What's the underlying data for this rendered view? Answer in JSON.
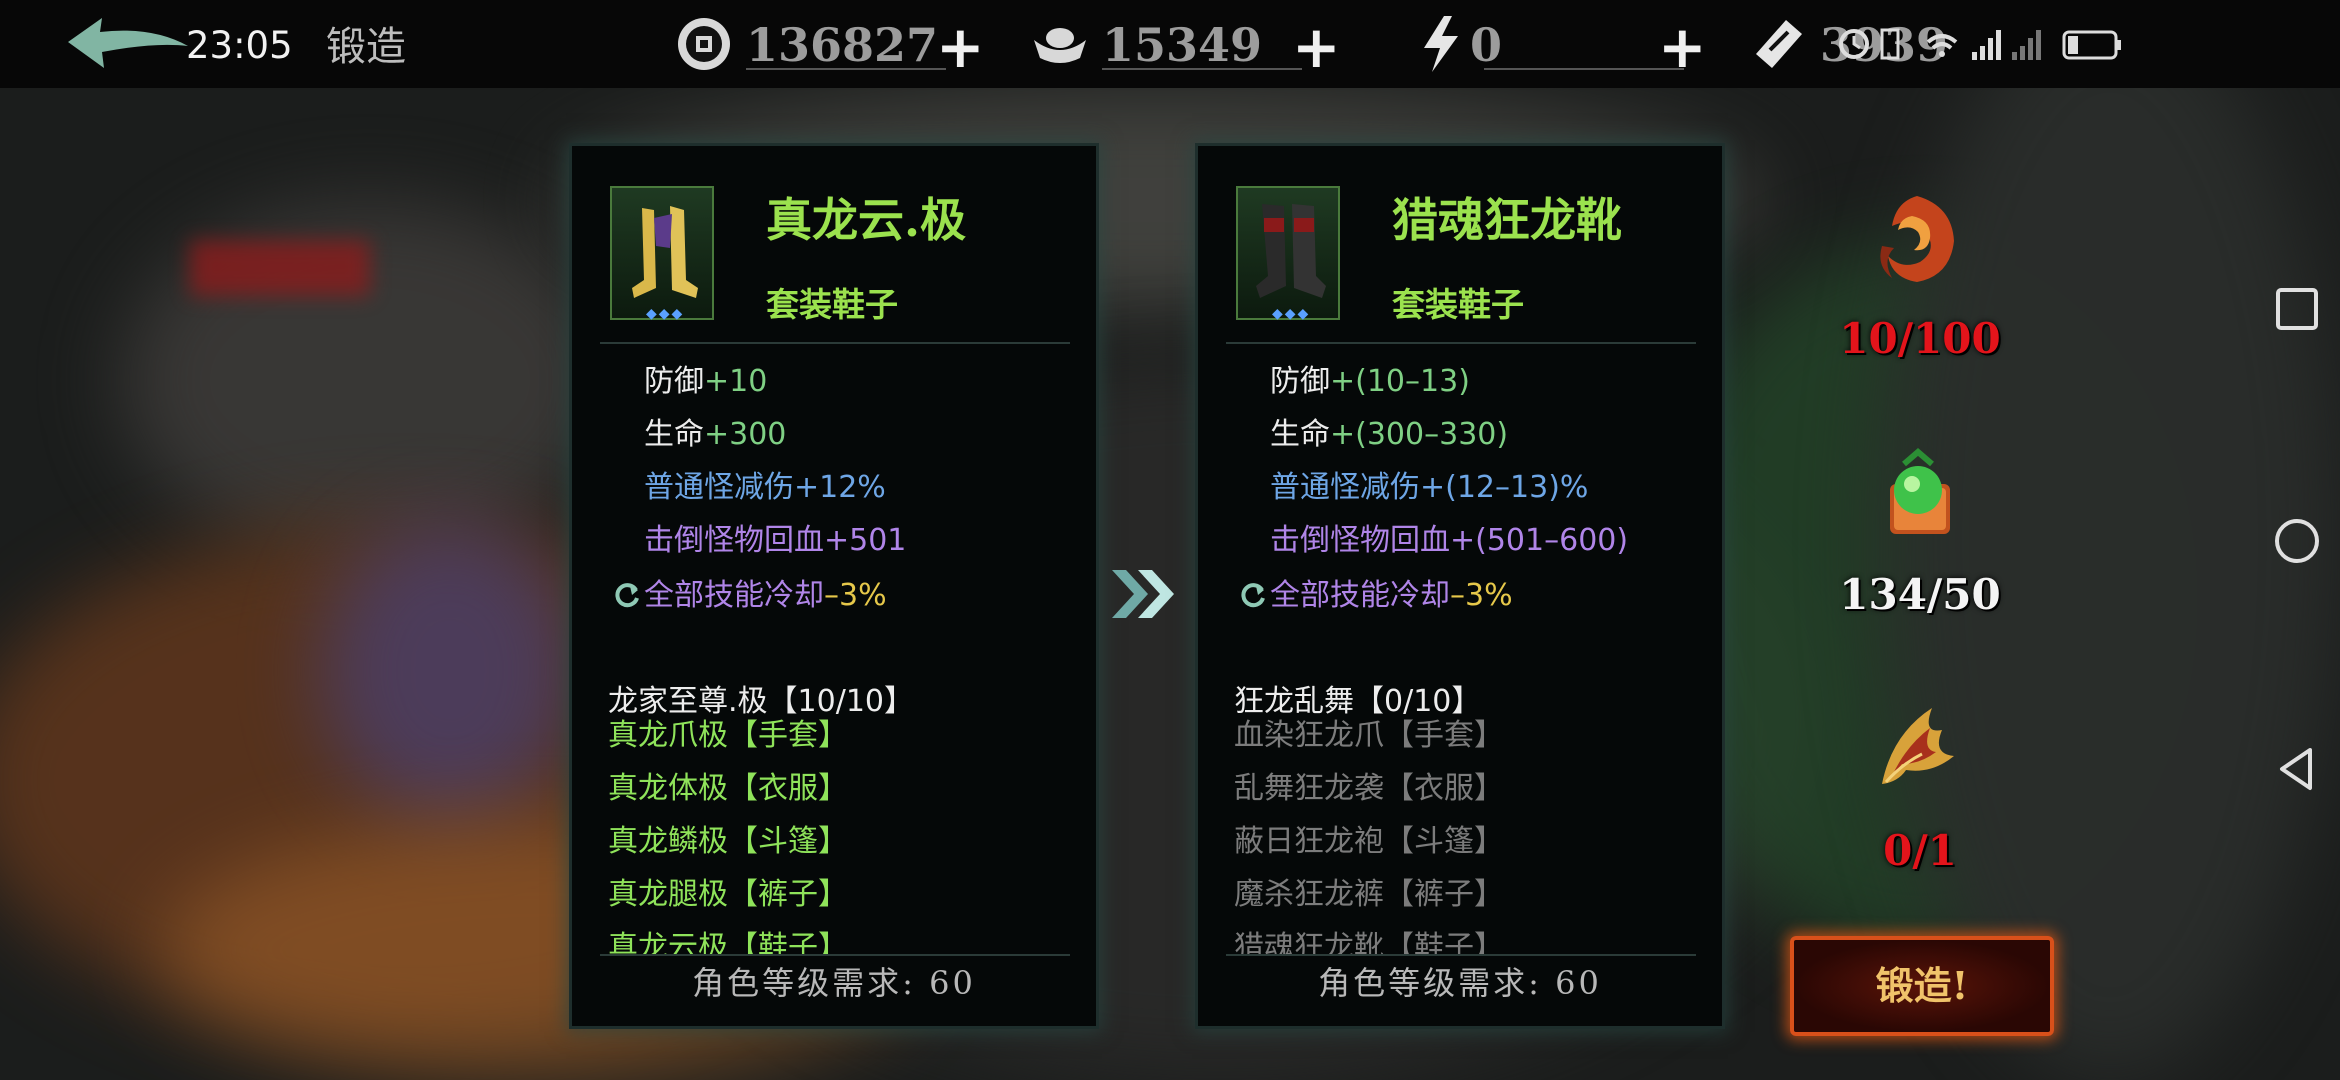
{
  "status": {
    "time": "23:05"
  },
  "header": {
    "title": "锻造"
  },
  "resources": [
    {
      "icon": "coin-icon",
      "value": "136827"
    },
    {
      "icon": "silver-ingot-icon",
      "value": "15349"
    },
    {
      "icon": "lightning-icon",
      "value": "0"
    },
    {
      "icon": "ticket-icon",
      "value": "3939"
    }
  ],
  "current_item": {
    "name": "真龙云.极",
    "type": "套装鞋子",
    "stats": [
      {
        "key": "防御",
        "value": "+10"
      },
      {
        "key": "生命",
        "value": "+300"
      },
      {
        "key": "普通怪减伤",
        "value": "+12%"
      },
      {
        "key": "击倒怪物回血",
        "value": "+501"
      },
      {
        "key": "全部技能冷却",
        "value": "–3%"
      }
    ],
    "set_name": "龙家至尊.极【10/10】",
    "set_items": [
      "真龙爪极【手套】",
      "真龙体极【衣服】",
      "真龙鳞极【斗篷】",
      "真龙腿极【裤子】",
      "真龙云极【鞋子】"
    ],
    "requirement": "角色等级需求: 60"
  },
  "result_item": {
    "name": "猎魂狂龙靴",
    "type": "套装鞋子",
    "stats": [
      {
        "key": "防御",
        "value": "+(10–13)"
      },
      {
        "key": "生命",
        "value": "+(300–330)"
      },
      {
        "key": "普通怪减伤",
        "value": "+(12–13)%"
      },
      {
        "key": "击倒怪物回血",
        "value": "+(501–600)"
      },
      {
        "key": "全部技能冷却",
        "value": "–3%"
      }
    ],
    "set_name": "狂龙乱舞【0/10】",
    "set_items": [
      "血染狂龙爪【手套】",
      "乱舞狂龙袭【衣服】",
      "蔽日狂龙袍【斗篷】",
      "魔杀狂龙裤【裤子】",
      "猎魂狂龙靴【鞋子】"
    ],
    "requirement": "角色等级需求: 60"
  },
  "materials": [
    {
      "icon": "flame-swirl-icon",
      "count": "10/100",
      "color": "#e3141b"
    },
    {
      "icon": "green-orb-icon",
      "count": "134/50",
      "color": "#f4f4f4"
    },
    {
      "icon": "phoenix-feather-icon",
      "count": "0/1",
      "color": "#e3141b"
    }
  ],
  "forge_button": {
    "label": "锻造!"
  }
}
